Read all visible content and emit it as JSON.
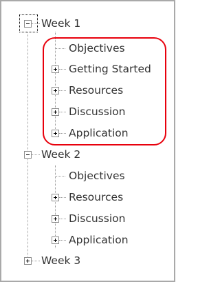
{
  "tree": {
    "week1": {
      "label": "Week 1",
      "expanded": true,
      "children": [
        "Objectives",
        "Getting Started",
        "Resources",
        "Discussion",
        "Application"
      ]
    },
    "week2": {
      "label": "Week 2",
      "expanded": true,
      "children": [
        "Objectives",
        "Resources",
        "Discussion",
        "Application"
      ]
    },
    "week3": {
      "label": "Week 3",
      "expanded": false
    }
  },
  "colors": {
    "highlight": "#e8000c"
  }
}
